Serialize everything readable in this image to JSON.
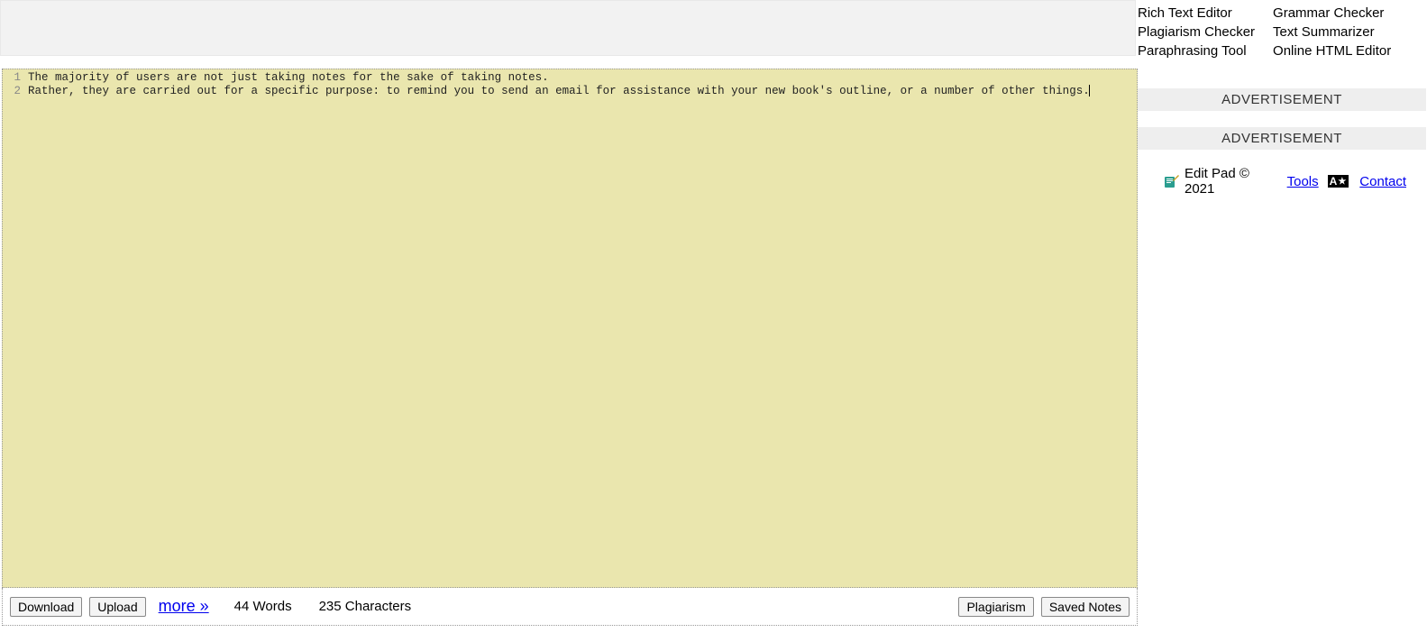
{
  "header": {
    "col1": [
      {
        "label": "Rich Text Editor"
      },
      {
        "label": "Plagiarism Checker"
      },
      {
        "label": "Paraphrasing Tool"
      }
    ],
    "col2": [
      {
        "label": "Grammar Checker"
      },
      {
        "label": "Text Summarizer"
      },
      {
        "label": "Online HTML Editor"
      }
    ]
  },
  "editor": {
    "lines": [
      {
        "num": "1",
        "text": "The majority of users are not just taking notes for the sake of taking notes."
      },
      {
        "num": "2",
        "text": "Rather, they are carried out for a specific purpose: to remind you to send an email for assistance with your new book's outline, or a number of other things."
      }
    ]
  },
  "bottom": {
    "download_label": "Download",
    "upload_label": "Upload",
    "more_label": "more »",
    "words_text": "44 Words",
    "chars_text": "235 Characters",
    "plagiarism_label": "Plagiarism",
    "saved_notes_label": "Saved Notes"
  },
  "sidebar": {
    "ad_label": "ADVERTISEMENT",
    "footer_text": "Edit Pad © 2021 ",
    "tools_link": "Tools",
    "ax_badge": "A",
    "contact_link": "Contact"
  }
}
